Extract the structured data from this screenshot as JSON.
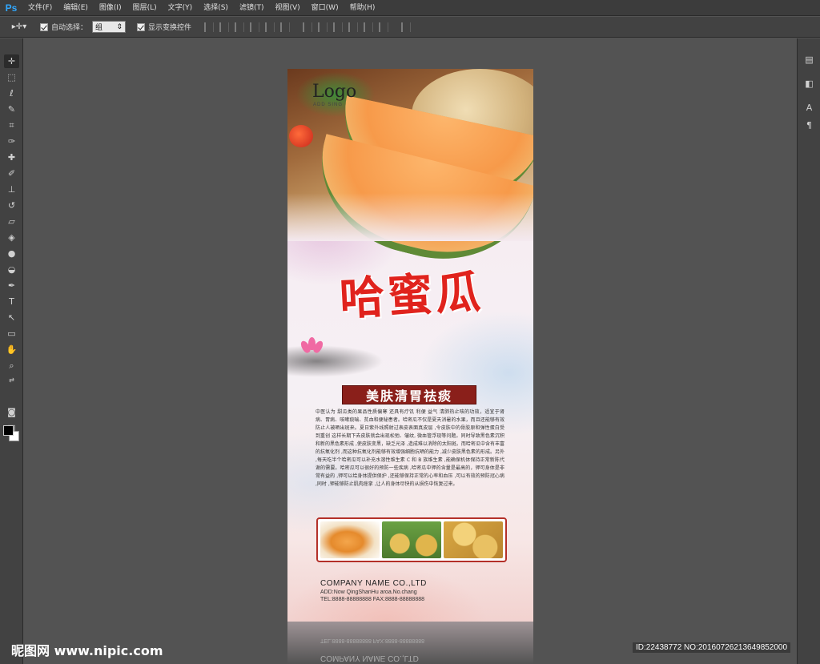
{
  "app": {
    "logo": "Ps"
  },
  "menu": [
    "文件(F)",
    "编辑(E)",
    "图像(I)",
    "图层(L)",
    "文字(Y)",
    "选择(S)",
    "滤镜(T)",
    "视图(V)",
    "窗口(W)",
    "帮助(H)"
  ],
  "options_bar": {
    "auto_select_label": "自动选择：",
    "auto_select_value": "组",
    "show_transform_label": "显示变换控件"
  },
  "poster": {
    "logo": "Logo",
    "logo_sub": "ADD SING",
    "title": "哈蜜瓜",
    "subtitle": "美肤清胃祛痰",
    "description": "中医认为 甜瓜类的果品性质偏寒 还具有疗饥 利便 益气 清肺热止咳的功效，适宜于肾病、胃病、咳嗽痰喘、贫血和便秘患者。哈密瓜不仅是夏天消暑的水果，而且还能够有效防止人被晒出斑来。夏日紫外线照射过表皮表面真皮层 ,令皮肤中的骨胶原和弹性蛋白受到重创 这样长期下去皮肤就会出现松弛、皱纹, 微血管浮现等问题。同时导致黑色素沉积和新的黑色素形成 ,使皮肤变黑，缺乏光泽 ,造成难以消除的太阳斑。而哈密瓜中含有丰富的抗氧化剂 ,而这种抗氧化剂能够有效增强细胞抗晒的能力 ,减少皮肤黑色素的形成。另外 ,每天吃半个哈密瓜可以补充水溶性维生素 C 和 B 族维生素 ,能确保机体保持正常新陈代谢的需要。哈密瓜可以很好的预防一些疾病 ,哈密瓜中钾的含量是最高的，钾可身体是非常有益的 ,钾可以给身体提供保护 ,还能够保持正常的心率和血压 ,可以有效的预防冠心病 ,同时 ,钾能够防止肌肉痉挛 ,让人的身体尽快的从损伤中恢复过来。",
    "company": "COMPANY NAME CO.,LTD",
    "address": "ADD:Now QingShanHu aroa.No.chang",
    "tel": "TEL:8888-88888888  FAX:8888-88888888"
  },
  "watermark": {
    "left": "昵图网 www.nipic.com",
    "right": "ID:22438772 NO:20160726213649852000"
  },
  "icons": {
    "move": "move-tool-icon",
    "hand": "hand-tool-icon"
  }
}
